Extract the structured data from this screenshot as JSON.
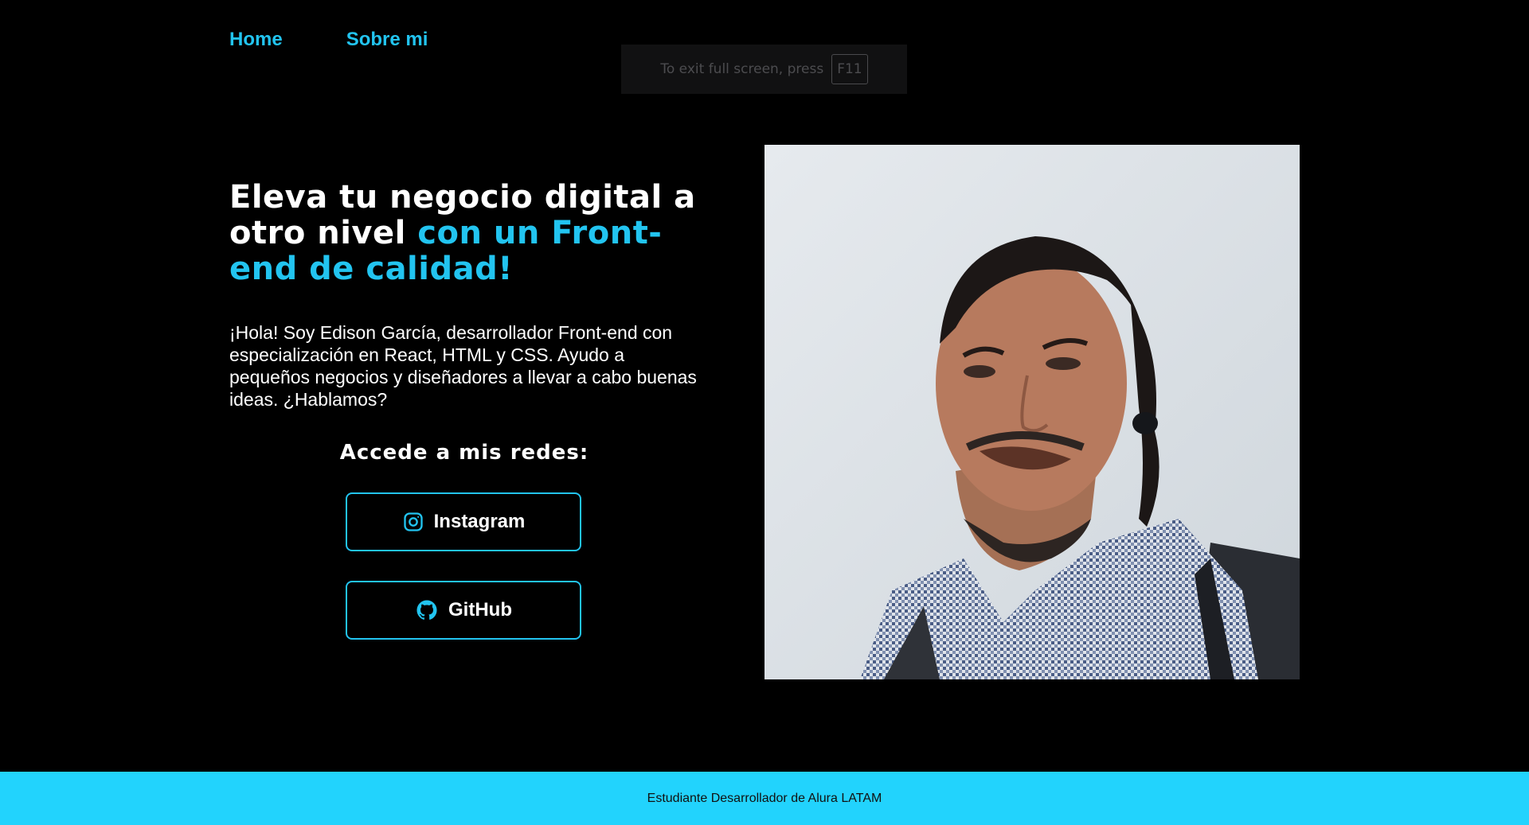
{
  "nav": {
    "items": [
      {
        "label": "Home"
      },
      {
        "label": "Sobre mi"
      }
    ]
  },
  "fullscreen_hint": {
    "text": "To exit full screen, press",
    "key": "F11"
  },
  "hero": {
    "title_plain": "Eleva tu negocio digital a otro nivel ",
    "title_accent": "con un Front-end de calidad!",
    "bio": "¡Hola! Soy Edison García, desarrollador Front-end con especialización en React, HTML y CSS. Ayudo a pequeños negocios y diseñadores a llevar a cabo buenas ideas. ¿Hablamos?",
    "social_title": "Accede a mis redes:",
    "buttons": [
      {
        "label": "Instagram",
        "icon": "instagram-icon"
      },
      {
        "label": "GitHub",
        "icon": "github-icon"
      }
    ]
  },
  "footer": {
    "text": "Estudiante Desarrollador de Alura LATAM"
  },
  "colors": {
    "accent": "#22c4f0",
    "footer_bg": "#22d3fd",
    "background": "#000000"
  }
}
